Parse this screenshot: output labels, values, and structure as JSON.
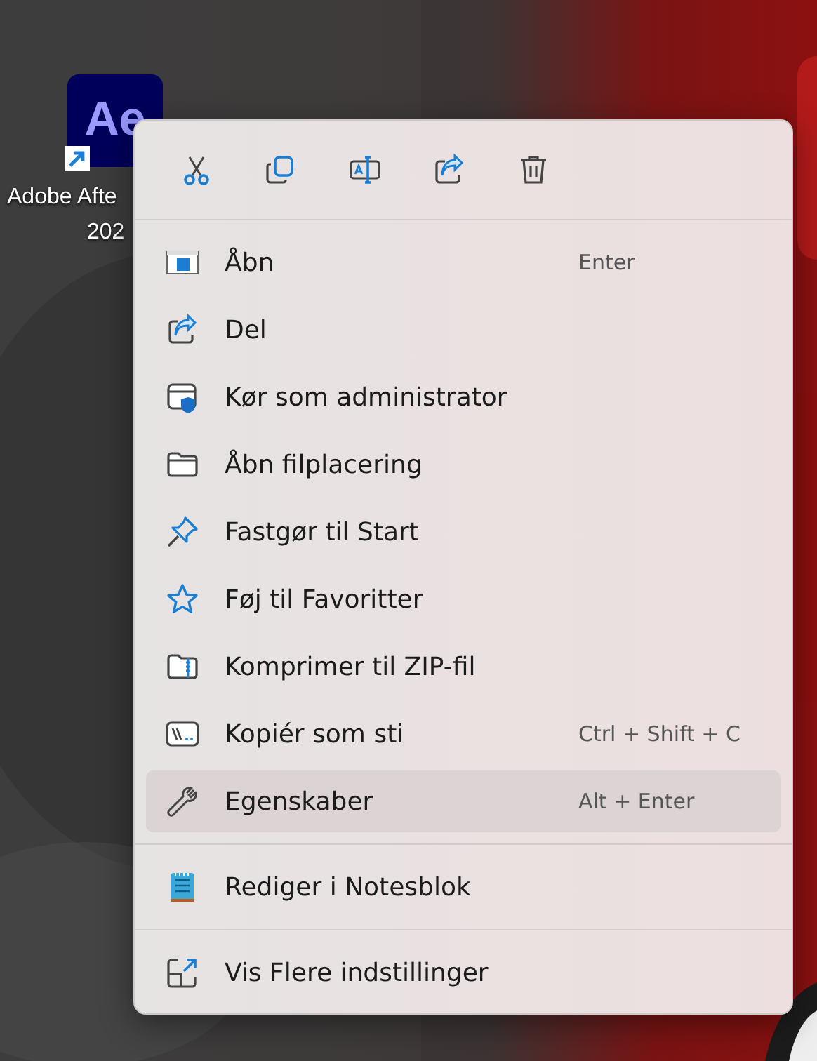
{
  "desktop_icon": {
    "logo": "Ae",
    "label_lines": [
      "Adobe Afte",
      "202"
    ]
  },
  "context_menu": {
    "toolbar": [
      {
        "kind": "cut"
      },
      {
        "kind": "copy"
      },
      {
        "kind": "rename"
      },
      {
        "kind": "share"
      },
      {
        "kind": "delete"
      }
    ],
    "sections": [
      {
        "items": [
          {
            "label": "Åbn",
            "shortcut": "Enter",
            "selected": false
          },
          {
            "label": "Del",
            "selected": false
          },
          {
            "label": "Kør som administrator",
            "selected": false
          },
          {
            "label": "Åbn filplacering",
            "selected": false
          },
          {
            "label": "Fastgør til Start",
            "selected": false
          },
          {
            "label": "Føj til Favoritter",
            "selected": false
          },
          {
            "label": "Komprimer til ZIP-fil",
            "selected": false
          },
          {
            "label": "Kopiér som sti",
            "shortcut": "Ctrl + Shift + C",
            "selected": false
          },
          {
            "label": "Egenskaber",
            "shortcut": "Alt + Enter",
            "selected": true
          }
        ]
      },
      {
        "items": [
          {
            "label": "Rediger i Notesblok",
            "selected": false
          }
        ]
      },
      {
        "items": [
          {
            "label": "Vis Flere indstillinger",
            "selected": false
          }
        ]
      }
    ]
  }
}
